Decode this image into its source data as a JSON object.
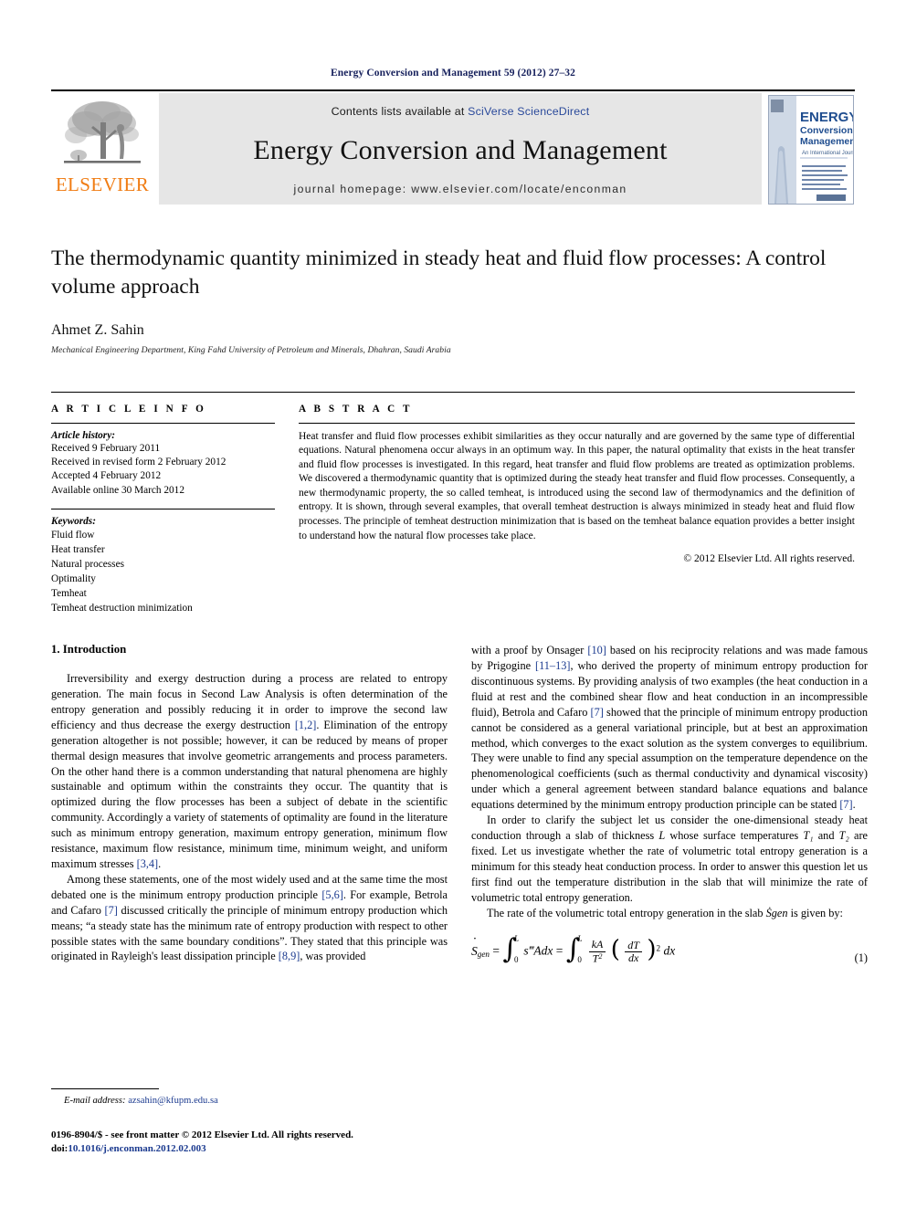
{
  "running_head": "Energy Conversion and Management 59 (2012) 27–32",
  "masthead": {
    "publisher_name": "ELSEVIER",
    "contents_prefix": "Contents lists available at ",
    "contents_link": "SciVerse ScienceDirect",
    "journal_title": "Energy Conversion and Management",
    "homepage": "journal homepage: www.elsevier.com/locate/enconman",
    "cover": {
      "line1": "ENERGY",
      "line2": "Conversion and",
      "line3": "Management",
      "line4": "An International Journal"
    }
  },
  "article": {
    "title": "The thermodynamic quantity minimized in steady heat and fluid flow processes: A control volume approach",
    "author": "Ahmet Z. Sahin",
    "affiliation": "Mechanical Engineering Department, King Fahd University of Petroleum and Minerals, Dhahran, Saudi Arabia"
  },
  "article_info": {
    "heading": "A R T I C L E   I N F O",
    "history_label": "Article history:",
    "history": [
      "Received 9 February 2011",
      "Received in revised form 2 February 2012",
      "Accepted 4 February 2012",
      "Available online 30 March 2012"
    ],
    "keywords_label": "Keywords:",
    "keywords": [
      "Fluid flow",
      "Heat transfer",
      "Natural processes",
      "Optimality",
      "Temheat",
      "Temheat destruction minimization"
    ]
  },
  "abstract": {
    "heading": "A B S T R A C T",
    "text": "Heat transfer and fluid flow processes exhibit similarities as they occur naturally and are governed by the same type of differential equations. Natural phenomena occur always in an optimum way. In this paper, the natural optimality that exists in the heat transfer and fluid flow processes is investigated. In this regard, heat transfer and fluid flow problems are treated as optimization problems. We discovered a thermodynamic quantity that is optimized during the steady heat transfer and fluid flow processes. Consequently, a new thermodynamic property, the so called temheat, is introduced using the second law of thermodynamics and the definition of entropy. It is shown, through several examples, that overall temheat destruction is always minimized in steady heat and fluid flow processes. The principle of temheat destruction minimization that is based on the temheat balance equation provides a better insight to understand how the natural flow processes take place.",
    "copyright": "© 2012 Elsevier Ltd. All rights reserved."
  },
  "body": {
    "section_title": "1. Introduction",
    "left_paragraphs": [
      {
        "segments": [
          {
            "t": "Irreversibility and exergy destruction during a process are related to entropy generation. The main focus in Second Law Analysis is often determination of the entropy generation and possibly reducing it in order to improve the second law efficiency and thus decrease the exergy destruction "
          },
          {
            "t": "[1,2]",
            "ref": true
          },
          {
            "t": ". Elimination of the entropy generation altogether is not possible; however, it can be reduced by means of proper thermal design measures that involve geometric arrangements and process parameters. On the other hand there is a common understanding that natural phenomena are highly sustainable and optimum within the constraints they occur. The quantity that is optimized during the flow processes has been a subject of debate in the scientific community. Accordingly a variety of statements of optimality are found in the literature such as minimum entropy generation, maximum entropy generation, minimum flow resistance, maximum flow resistance, minimum time, minimum weight, and uniform maximum stresses "
          },
          {
            "t": "[3,4]",
            "ref": true
          },
          {
            "t": "."
          }
        ]
      },
      {
        "segments": [
          {
            "t": "Among these statements, one of the most widely used and at the same time the most debated one is the minimum entropy production principle "
          },
          {
            "t": "[5,6]",
            "ref": true
          },
          {
            "t": ". For example, Betrola and Cafaro "
          },
          {
            "t": "[7]",
            "ref": true
          },
          {
            "t": " discussed critically the principle of minimum entropy production which means; “a steady state has the minimum rate of entropy production with respect to other possible states with the same boundary conditions”. They stated that this principle was originated in Rayleigh's least dissipation principle "
          },
          {
            "t": "[8,9]",
            "ref": true
          },
          {
            "t": ", was provided"
          }
        ]
      }
    ],
    "right_paragraphs": [
      {
        "no_indent": true,
        "segments": [
          {
            "t": "with a proof by Onsager "
          },
          {
            "t": "[10]",
            "ref": true
          },
          {
            "t": " based on his reciprocity relations and was made famous by Prigogine "
          },
          {
            "t": "[11–13]",
            "ref": true
          },
          {
            "t": ", who derived the property of minimum entropy production for discontinuous systems. By providing analysis of two examples (the heat conduction in a fluid at rest and the combined shear flow and heat conduction in an incompressible fluid), Betrola and Cafaro "
          },
          {
            "t": "[7]",
            "ref": true
          },
          {
            "t": " showed that the principle of minimum entropy production cannot be considered as a general variational principle, but at best an approximation method, which converges to the exact solution as the system converges to equilibrium. They were unable to find any special assumption on the temperature dependence on the phenomenological coefficients (such as thermal conductivity and dynamical viscosity) under which a general agreement between standard balance equations and balance equations determined by the minimum entropy production principle can be stated "
          },
          {
            "t": "[7]",
            "ref": true
          },
          {
            "t": "."
          }
        ]
      },
      {
        "segments": [
          {
            "t": "In order to clarify the subject let us consider the one-dimensional steady heat conduction through a slab of thickness "
          },
          {
            "t": "L",
            "italic": true
          },
          {
            "t": " whose surface temperatures "
          },
          {
            "t": "T₁",
            "italic": true
          },
          {
            "t": " and "
          },
          {
            "t": "T₂",
            "italic": true
          },
          {
            "t": " are fixed. Let us investigate whether the rate of volumetric total entropy generation is a minimum for this steady heat conduction process. In order to answer this question let us first find out the temperature distribution in the slab that will minimize the rate of volumetric total entropy generation."
          }
        ]
      },
      {
        "segments": [
          {
            "t": "The rate of the volumetric total entropy generation in the slab "
          },
          {
            "t": "Ṡgen",
            "italic": true
          },
          {
            "t": " is given by:"
          }
        ]
      }
    ],
    "equation": {
      "number": "(1)",
      "latex": "Ṡ_gen = ∫₀^L s‴A dx = ∫₀^L (kA/T²)(dT/dx)² dx",
      "symbols": {
        "lhs": "S",
        "lhs_sub": "gen",
        "integrand1": "s‴Adx",
        "upper_limit": "L",
        "lower_limit": "0",
        "num": "kA",
        "den": "T",
        "den_exp": "2",
        "inner_num": "dT",
        "inner_den": "dx",
        "inner_exp": "2",
        "tail": "dx"
      }
    }
  },
  "footnote": {
    "label": "E-mail address:",
    "email": "azsahin@kfupm.edu.sa"
  },
  "footer": {
    "line1": "0196-8904/$ - see front matter © 2012 Elsevier Ltd. All rights reserved.",
    "doi_label": "doi:",
    "doi": "10.1016/j.enconman.2012.02.003"
  },
  "colors": {
    "link": "#1b3a8f",
    "running_head": "#16205c",
    "elsevier_orange": "#f07c13",
    "masthead_gray": "#e6e6e6"
  }
}
